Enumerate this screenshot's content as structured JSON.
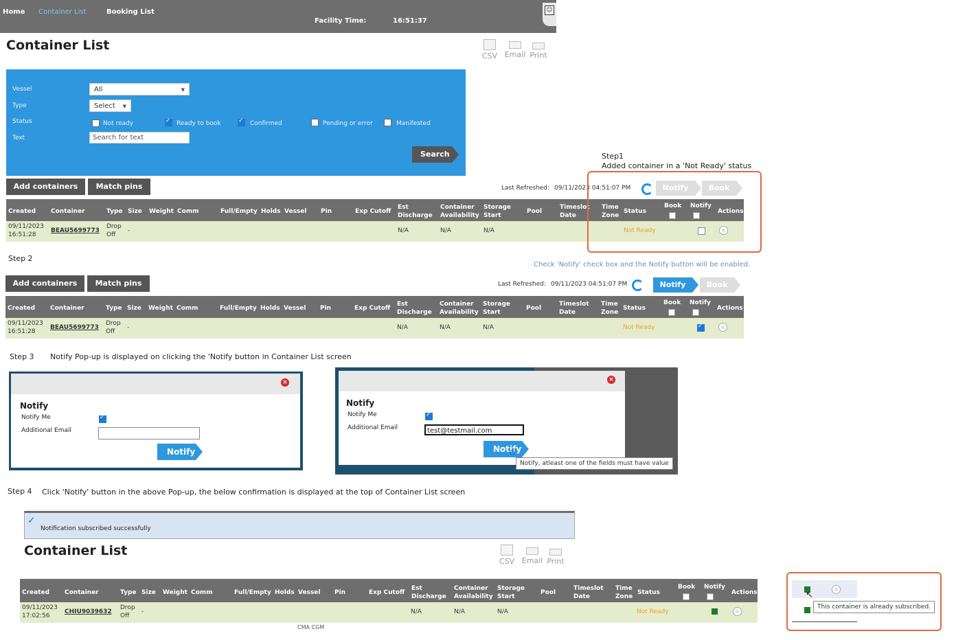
{
  "nav": {
    "home": "Home",
    "container_list": "Container List",
    "booking_list": "Booking List",
    "facility_time_label": "Facility Time:",
    "facility_time": "16:51:37"
  },
  "page": {
    "title": "Container List"
  },
  "tools": {
    "csv": "CSV",
    "email": "Email",
    "print": "Print"
  },
  "filter": {
    "vessel_label": "Vessel",
    "vessel_value": "All",
    "type_label": "Type",
    "type_value": "Select",
    "status_label": "Status",
    "statuses": [
      {
        "label": "Not ready",
        "checked": false
      },
      {
        "label": "Ready to book",
        "checked": true
      },
      {
        "label": "Confirmed",
        "checked": true
      },
      {
        "label": "Pending or error",
        "checked": false
      },
      {
        "label": "Manifested",
        "checked": false
      }
    ],
    "text_label": "Text",
    "text_placeholder": "Search for text",
    "search_label": "Search"
  },
  "actions": {
    "add_containers": "Add containers",
    "match_pins": "Match pins",
    "last_refreshed_label": "Last Refreshed:",
    "last_refreshed": "09/11/2023 04:51:07 PM",
    "notify": "Notify",
    "book": "Book"
  },
  "table": {
    "headers": {
      "created": "Created",
      "container": "Container",
      "type": "Type",
      "size": "Size",
      "weight": "Weight",
      "comm": "Comm",
      "full_empty": "Full/Empty",
      "holds": "Holds",
      "vessel": "Vessel",
      "pin": "Pin",
      "exp_cutoff": "Exp Cutoff",
      "est_discharge_1": "Est",
      "est_discharge_2": "Discharge",
      "container_avail_1": "Container",
      "container_avail_2": "Availability",
      "storage_start_1": "Storage",
      "storage_start_2": "Start",
      "pool": "Pool",
      "timeslot_1": "Timeslot",
      "timeslot_2": "Date",
      "time_zone_1": "Time",
      "time_zone_2": "Zone",
      "status": "Status",
      "book": "Book",
      "notify": "Notify",
      "actions": "Actions"
    },
    "row1": {
      "created_date": "09/11/2023",
      "created_time": "16:51:28",
      "container": "BEAU5699773",
      "type_1": "Drop",
      "type_2": "Off",
      "size": "-",
      "est_discharge": "N/A",
      "container_avail": "N/A",
      "storage_start": "N/A",
      "status": "Not Ready"
    },
    "row2": {
      "created_date": "09/11/2023",
      "created_time": "17:02:56",
      "container": "CHIU9039632",
      "type_1": "Drop",
      "type_2": "Off",
      "size": "-",
      "est_discharge": "N/A",
      "container_avail": "N/A",
      "storage_start": "N/A",
      "status": "Not Ready"
    },
    "below_row_text": "CMA CGM"
  },
  "steps": {
    "step1_title": "Step1",
    "step1_desc": "Added container in a 'Not Ready' status",
    "step2_title": "Step 2",
    "step2_desc": "Check 'Notify' check box and the Notify button will be enabled.",
    "step3_title": "Step 3",
    "step3_desc": "Notify Pop-up is displayed on clicking the 'Notify button in Container List screen",
    "step4_title": "Step 4",
    "step4_desc": "Click 'Notify' button in the above Pop-up, the below confirmation is displayed at the top of Container List screen"
  },
  "popup": {
    "title": "Notify",
    "notify_me": "Notify Me",
    "additional_email": "Additional Email",
    "email_value": "test@testmail.com",
    "button": "Notify",
    "tooltip": "Notify, atleast one of the fields must have value"
  },
  "banner": {
    "message": "Notification subscribed successfully"
  },
  "inset": {
    "tooltip": "This container is already subscribed."
  },
  "colors": {
    "accent": "#2f97dd",
    "header": "#6e6e6e",
    "row": "#e4eccd",
    "highlight": "#e06a44",
    "status": "#f0a020"
  }
}
